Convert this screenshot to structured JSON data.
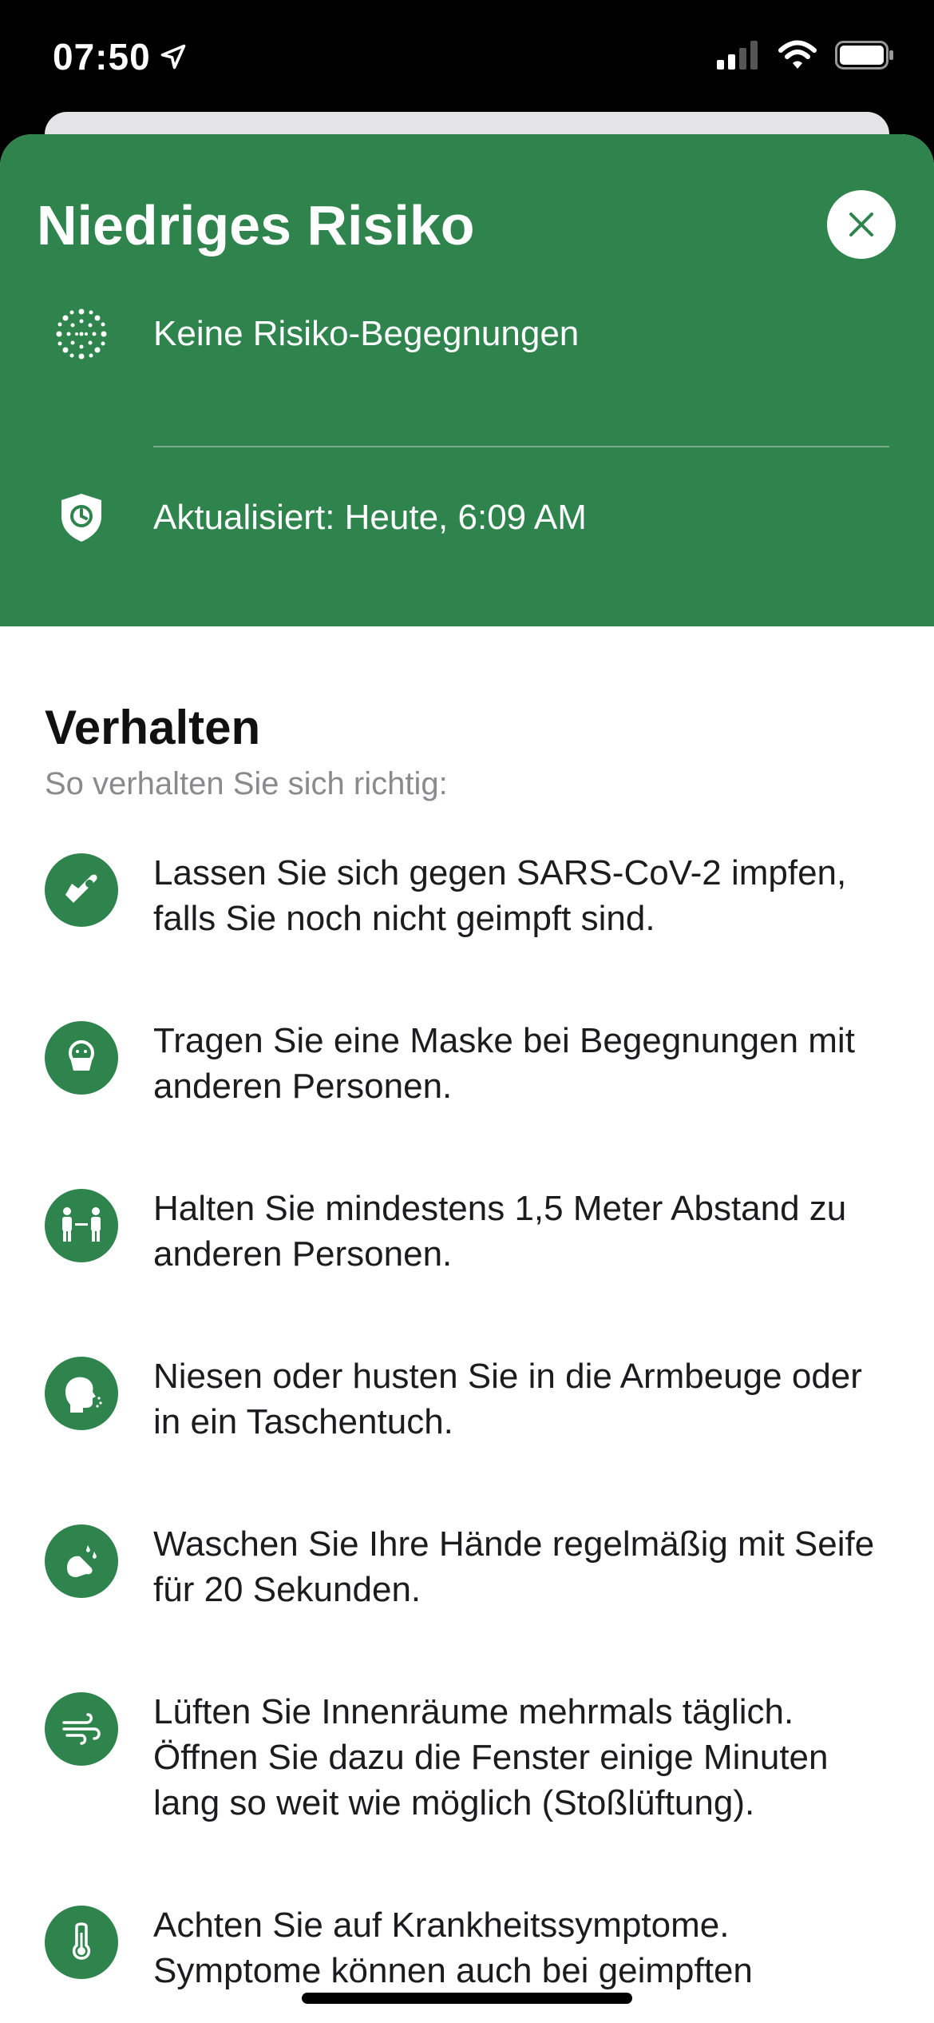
{
  "status_bar": {
    "time": "07:50"
  },
  "header": {
    "title": "Niedriges Risiko",
    "rows": [
      {
        "icon": "exposure-dots-icon",
        "text": "Keine Risiko-Begegnungen"
      },
      {
        "icon": "shield-clock-icon",
        "text": "Aktualisiert: Heute, 6:09 AM"
      }
    ],
    "color": "#2e844c"
  },
  "section": {
    "title": "Verhalten",
    "subtitle": "So verhalten Sie sich richtig:",
    "items": [
      {
        "icon": "vaccine-arm-icon",
        "text": "Lassen Sie sich gegen SARS-CoV-2 impfen, falls Sie noch nicht geimpft sind."
      },
      {
        "icon": "mask-icon",
        "text": "Tragen Sie eine Maske bei Begegnungen mit anderen Personen."
      },
      {
        "icon": "distance-icon",
        "text": "Halten Sie mindestens 1,5 Meter Abstand zu anderen Personen."
      },
      {
        "icon": "sneeze-icon",
        "text": "Niesen oder husten Sie in die Armbeuge oder in ein Taschentuch."
      },
      {
        "icon": "handwash-icon",
        "text": "Waschen Sie Ihre Hände regelmäßig mit Seife für 20 Sekunden."
      },
      {
        "icon": "ventilation-icon",
        "text": "Lüften Sie Innenräume mehrmals täglich. Öffnen Sie dazu die Fenster einige Minuten lang so weit wie möglich (Stoßlüftung)."
      },
      {
        "icon": "thermometer-icon",
        "text": "Achten Sie auf Krankheitssymptome. Symptome können auch bei geimpften"
      }
    ]
  }
}
